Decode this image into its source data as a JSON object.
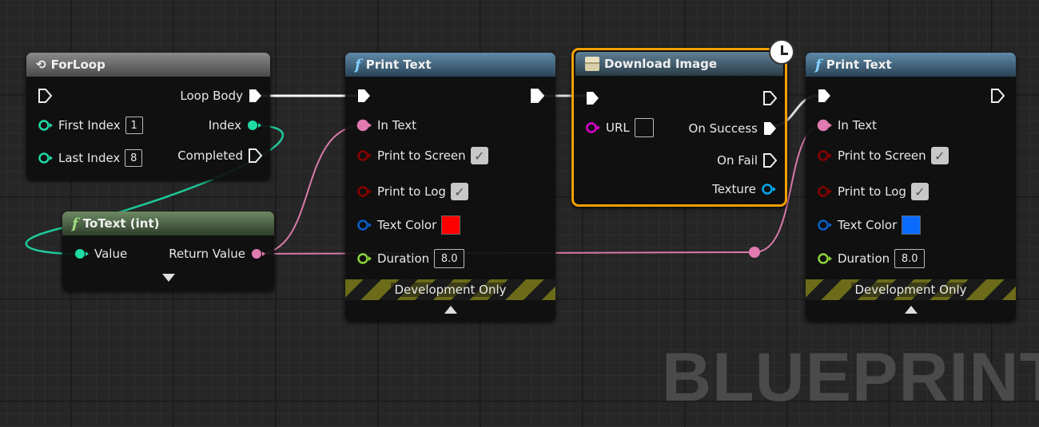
{
  "colors": {
    "exec": "#ffffff",
    "int": "#1fdba5",
    "text": "#e07ab0",
    "bool": "#8a0000",
    "color": "#0a5ec8",
    "float": "#8cd43a",
    "string": "#e000d0",
    "object": "#00a8f0",
    "selected": "#f5a000"
  },
  "for_loop": {
    "title": "ForLoop",
    "loop_body": "Loop Body",
    "first_index": "First Index",
    "first_index_value": "1",
    "last_index": "Last Index",
    "last_index_value": "8",
    "index": "Index",
    "completed": "Completed"
  },
  "to_text": {
    "title": "ToText (int)",
    "value": "Value",
    "return_value": "Return Value"
  },
  "print_text_1": {
    "title": "Print Text",
    "in_text": "In Text",
    "print_to_screen": "Print to Screen",
    "print_to_screen_checked": true,
    "print_to_log": "Print to Log",
    "print_to_log_checked": true,
    "text_color": "Text Color",
    "text_color_value": "#ff0000",
    "duration": "Duration",
    "duration_value": "8.0",
    "dev_only": "Development Only"
  },
  "download_image": {
    "title": "Download Image",
    "url": "URL",
    "url_value": "",
    "on_success": "On Success",
    "on_fail": "On Fail",
    "texture": "Texture"
  },
  "print_text_2": {
    "title": "Print Text",
    "in_text": "In Text",
    "print_to_screen": "Print to Screen",
    "print_to_screen_checked": true,
    "print_to_log": "Print to Log",
    "print_to_log_checked": true,
    "text_color": "Text Color",
    "text_color_value": "#0a6cff",
    "duration": "Duration",
    "duration_value": "8.0",
    "dev_only": "Development Only"
  },
  "watermark": "BLUEPRINT"
}
